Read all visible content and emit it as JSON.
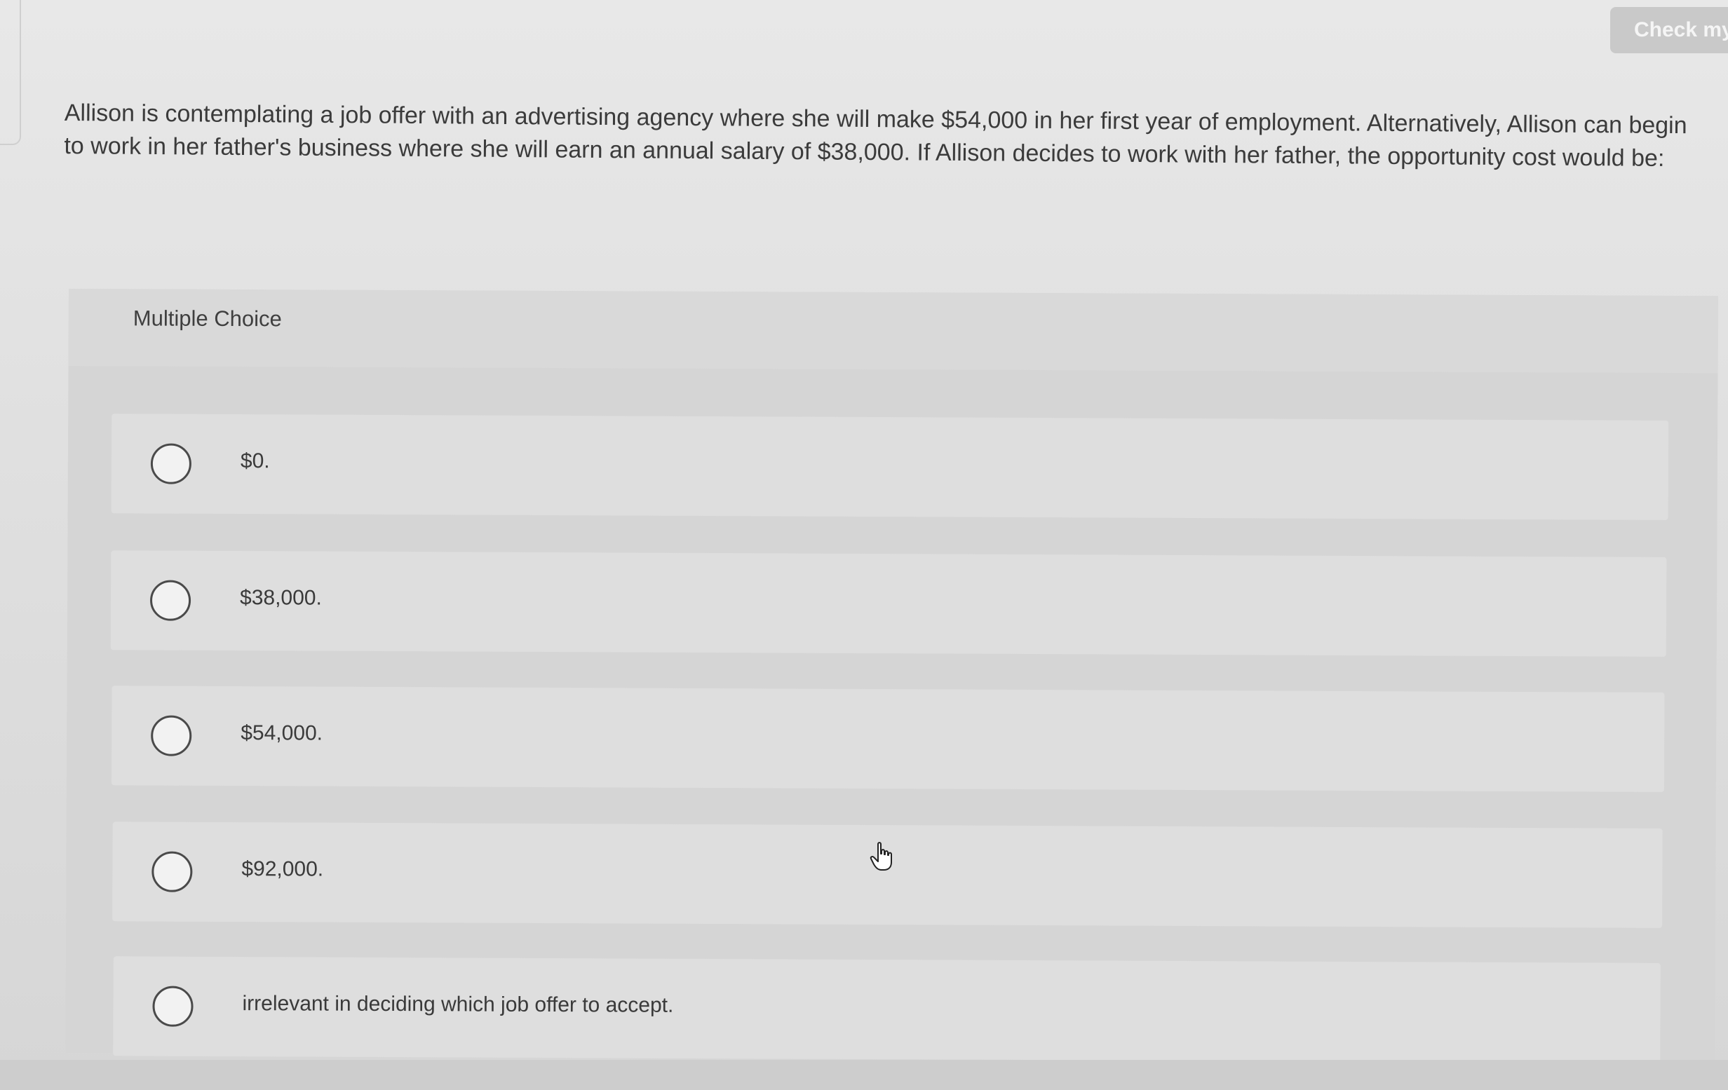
{
  "header": {
    "check_button_label": "Check my"
  },
  "question": {
    "text": "Allison is contemplating a job offer with an advertising agency where she will make $54,000 in her first year of employment. Alternatively, Allison can begin to work in her father's business where she will earn an annual salary of $38,000. If Allison decides to work with her father, the opportunity cost would be:"
  },
  "multiple_choice": {
    "title": "Multiple Choice",
    "options": [
      {
        "label": "$0."
      },
      {
        "label": "$38,000."
      },
      {
        "label": "$54,000."
      },
      {
        "label": "$92,000."
      },
      {
        "label": "irrelevant in deciding which job offer to accept."
      }
    ]
  },
  "icons": {
    "cursor": "hand-pointer-icon",
    "radio": "radio-circle-icon"
  }
}
